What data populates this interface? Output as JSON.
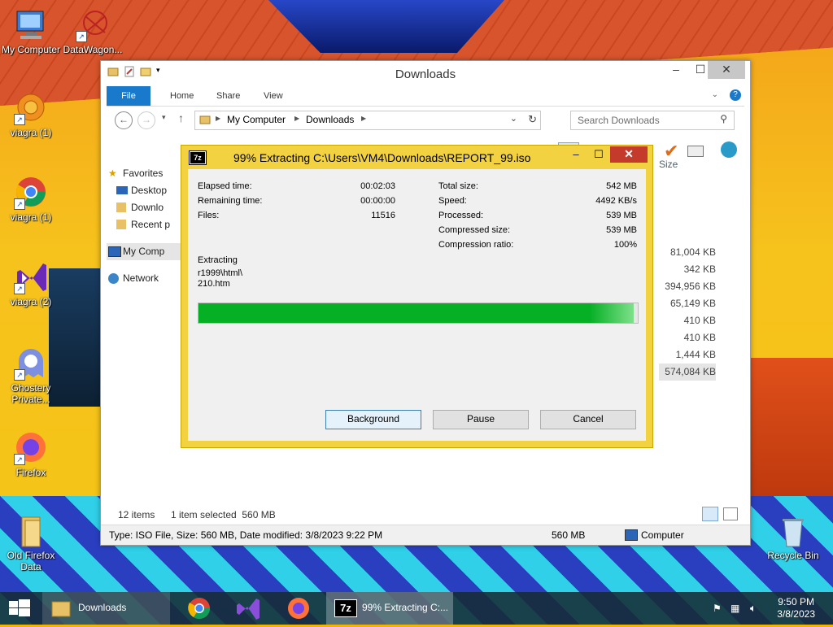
{
  "desktop": {
    "icons": [
      {
        "label": "My Computer"
      },
      {
        "label": "DataWagon..."
      },
      {
        "label": "viagra (1)"
      },
      {
        "label": "viagra (1)"
      },
      {
        "label": "viagra (2)"
      },
      {
        "label": "Ghostery Private..."
      },
      {
        "label": "Firefox"
      },
      {
        "label": "Old Firefox Data"
      },
      {
        "label": "Recycle Bin"
      }
    ]
  },
  "explorer": {
    "title": "Downloads",
    "tabs": [
      "File",
      "Home",
      "Share",
      "View"
    ],
    "breadcrumb": [
      "My Computer",
      "Downloads"
    ],
    "search_placeholder": "Search Downloads",
    "nav": {
      "favorites": "Favorites",
      "desktop": "Desktop",
      "downloads": "Downlo",
      "recent": "Recent p",
      "computer": "My Comp",
      "network": "Network"
    },
    "size_header": "Size",
    "sizes": [
      "81,004 KB",
      "342 KB",
      "394,956 KB",
      "65,149 KB",
      "410 KB",
      "410 KB",
      "1,444 KB",
      "574,084 KB"
    ],
    "status_items": "12 items",
    "status_selected": "1 item selected  560 MB",
    "details_text": "Type: ISO File, Size: 560 MB, Date modified: 3/8/2023 9:22 PM",
    "details_size": "560 MB",
    "details_location": "Computer"
  },
  "dialog": {
    "title": "99% Extracting C:\\Users\\VM4\\Downloads\\REPORT_99.iso",
    "app_icon": "7z",
    "left": [
      {
        "k": "Elapsed time:",
        "v": "00:02:03"
      },
      {
        "k": "Remaining time:",
        "v": "00:00:00"
      },
      {
        "k": "Files:",
        "v": "11516"
      }
    ],
    "right": [
      {
        "k": "Total size:",
        "v": "542 MB"
      },
      {
        "k": "Speed:",
        "v": "4492 KB/s"
      },
      {
        "k": "Processed:",
        "v": "539 MB"
      },
      {
        "k": "Compressed size:",
        "v": "539 MB"
      },
      {
        "k": "Compression ratio:",
        "v": "100%"
      }
    ],
    "action": "Extracting",
    "path_line1": "r1999\\html\\",
    "path_line2": "210.htm",
    "progress": 0.99,
    "buttons": {
      "background": "Background",
      "pause": "Pause",
      "cancel": "Cancel"
    }
  },
  "taskbar": {
    "explorer_label": "Downloads",
    "sevenzip_label": "99% Extracting C:...",
    "time": "9:50 PM",
    "date": "3/8/2023"
  }
}
